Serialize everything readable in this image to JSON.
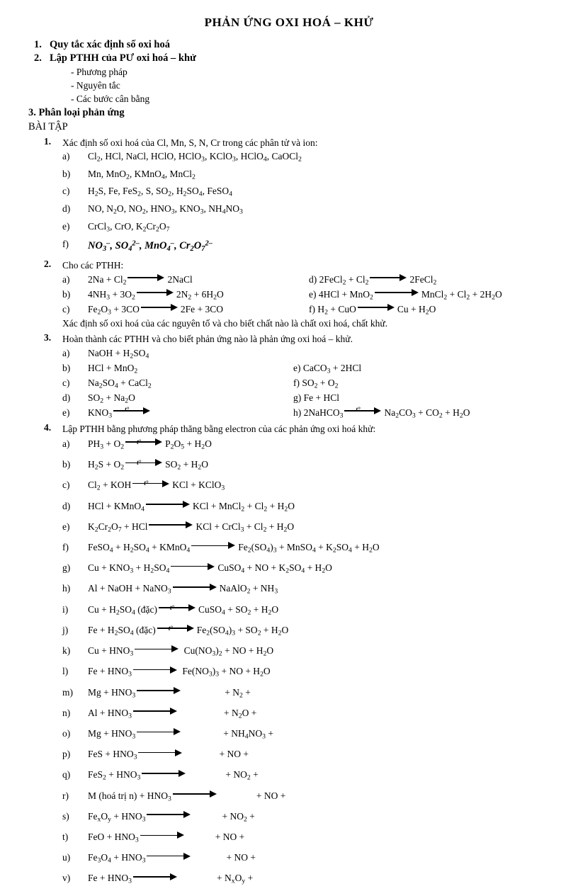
{
  "document": {
    "title": "PHẢN ỨNG OXI HOÁ – KHỬ",
    "outline": [
      {
        "num": "1.",
        "text": "Quy tắc xác định số oxi hoá"
      },
      {
        "num": "2.",
        "text": "Lập PTHH của PƯ oxi hoá – khử"
      }
    ],
    "sub_points": [
      "- Phương pháp",
      "- Nguyên tắc",
      "- Các bước cân bằng"
    ],
    "section3": "3. Phân loại phản ứng",
    "exercises_heading": "BÀI TẬP"
  },
  "ex1": {
    "num": "1.",
    "heading": "Xác định số oxi hoá của Cl, Mn, S, N, Cr trong các phân tử và ion:",
    "items": [
      {
        "label": "a)",
        "text": "Cl₂, HCl, NaCl, HClO, HClO₃, KClO₃, HClO₄, CaOCl₂"
      },
      {
        "label": "b)",
        "text": "Mn, MnO₂, KMnO₄, MnCl₂"
      },
      {
        "label": "c)",
        "text": "H₂S, Fe, FeS₂, S, SO₂, H₂SO₄, FeSO₄"
      },
      {
        "label": "d)",
        "text": "NO, N₂O, NO₂, HNO₃, KNO₃, NH₄NO₃"
      },
      {
        "label": "e)",
        "text": "CrCl₃, CrO, K₂Cr₂O₇"
      },
      {
        "label": "f)",
        "text": "NO₃⁻, SO₄²⁻, MnO₄⁻, Cr₂O₇²⁻"
      }
    ]
  },
  "ex2": {
    "num": "2.",
    "heading": "Cho các PTHH:",
    "rows": [
      {
        "left_label": "a)",
        "left": "2Na + Cl₂ ⟶ 2NaCl",
        "right": "d) 2FeCl₂ + Cl₂ ⟶ 2FeCl₂"
      },
      {
        "left_label": "b)",
        "left": "4NH₃ + 3O₂ ⟶ 2N₂ + 6H₂O",
        "right": "e) 4HCl + MnO₂ ⟶ MnCl₂ + Cl₂ + 2H₂O"
      },
      {
        "left_label": "c)",
        "left": "Fe₂O₃ + 3CO ⟶ 2Fe + 3CO",
        "right": "f) H₂ + CuO ⟶ Cu + H₂O"
      }
    ],
    "note": "Xác định số oxi hoá của các nguyên tố và cho biết chất nào là chất oxi hoá, chất khử."
  },
  "ex3": {
    "num": "3.",
    "heading": "Hoàn thành các PTHH và cho biết phản ứng nào là phản ứng oxi hoá – khử.",
    "rows": [
      {
        "left_label": "a)",
        "left": "NaOH + H₂SO₄",
        "right": ""
      },
      {
        "left_label": "b)",
        "left": "HCl + MnO₂",
        "right": "e) CaCO₃ + 2HCl"
      },
      {
        "left_label": "c)",
        "left": "Na₂SO₄ + CaCl₂",
        "right": "f) SO₂ + O₂"
      },
      {
        "left_label": "d)",
        "left": "SO₂ + Na₂O",
        "right": "g) Fe + HCl"
      },
      {
        "left_label": "e)",
        "left": "KNO₃ ⟶(t°)",
        "right": "h) 2NaHCO₃ ⟶(t°) Na₂CO₃ + CO₂ + H₂O"
      }
    ]
  },
  "ex4": {
    "num": "4.",
    "heading": "Lập PTHH bằng phương pháp thăng bằng electron của các phản ứng oxi hoá khử:",
    "condition_label": "t°",
    "items": [
      {
        "label": "a)",
        "lhs": "PH₃ + O₂",
        "cond": true,
        "rhs": "P₂O₅ + H₂O"
      },
      {
        "label": "b)",
        "lhs": "H₂S + O₂",
        "cond": true,
        "rhs": "SO₂ + H₂O"
      },
      {
        "label": "c)",
        "lhs": "Cl₂ + KOH",
        "cond": true,
        "rhs": "KCl + KClO₃"
      },
      {
        "label": "d)",
        "lhs": "HCl + KMnO₄",
        "cond": false,
        "rhs": "KCl + MnCl₂ + Cl₂ + H₂O"
      },
      {
        "label": "e)",
        "lhs": "K₂Cr₂O₇ + HCl",
        "cond": false,
        "rhs": "KCl + CrCl₃ + Cl₂ + H₂O"
      },
      {
        "label": "f)",
        "lhs": "FeSO₄ + H₂SO₄ + KMnO₄",
        "cond": false,
        "rhs": "Fe₂(SO₄)₃ + MnSO₄ + K₂SO₄ + H₂O"
      },
      {
        "label": "g)",
        "lhs": "Cu + KNO₃ + H₂SO₄",
        "cond": false,
        "rhs": "CuSO₄ + NO + K₂SO₄ + H₂O"
      },
      {
        "label": "h)",
        "lhs": "Al + NaOH + NaNO₃",
        "cond": false,
        "rhs": "NaAlO₂ + NH₃"
      },
      {
        "label": "i)",
        "lhs": "Cu + H₂SO₄ (đặc)",
        "cond": true,
        "rhs": "CuSO₄ + SO₂ + H₂O"
      },
      {
        "label": "j)",
        "lhs": "Fe + H₂SO₄ (đặc)",
        "cond": true,
        "rhs": "Fe₂(SO₄)₃ + SO₂ + H₂O"
      },
      {
        "label": "k)",
        "lhs": "Cu + HNO₃",
        "cond": false,
        "rhs": "Cu(NO₃)₂ + NO + H₂O"
      },
      {
        "label": "l)",
        "lhs": "Fe + HNO₃",
        "cond": false,
        "rhs": "Fe(NO₃)₃ + NO + H₂O"
      },
      {
        "label": "m)",
        "lhs": "Mg + HNO₃",
        "cond": false,
        "rhs": "+ N₂ +"
      },
      {
        "label": "n)",
        "lhs": "Al + HNO₃",
        "cond": false,
        "rhs": "+ N₂O +"
      },
      {
        "label": "o)",
        "lhs": "Mg + HNO₃",
        "cond": false,
        "rhs": "+ NH₄NO₃ +"
      },
      {
        "label": "p)",
        "lhs": "FeS + HNO₃",
        "cond": false,
        "rhs": "+ NO +"
      },
      {
        "label": "q)",
        "lhs": "FeS₂ + HNO₃",
        "cond": false,
        "rhs": "+ NO₂ +"
      },
      {
        "label": "r)",
        "lhs": "M (hoá trị n) + HNO₃",
        "cond": false,
        "rhs": "+ NO +"
      },
      {
        "label": "s)",
        "lhs": "FeₓO_y + HNO₃",
        "cond": false,
        "rhs": "+ NO₂ +"
      },
      {
        "label": "t)",
        "lhs": "FeO + HNO₃",
        "cond": false,
        "rhs": "+ NO +"
      },
      {
        "label": "u)",
        "lhs": "Fe₃O₄ + HNO₃",
        "cond": false,
        "rhs": "+ NO +"
      },
      {
        "label": "v)",
        "lhs": "Fe + HNO₃",
        "cond": false,
        "rhs": "+ NₓO_y +"
      }
    ]
  },
  "colors": {
    "text": "#000000",
    "background": "#ffffff"
  }
}
